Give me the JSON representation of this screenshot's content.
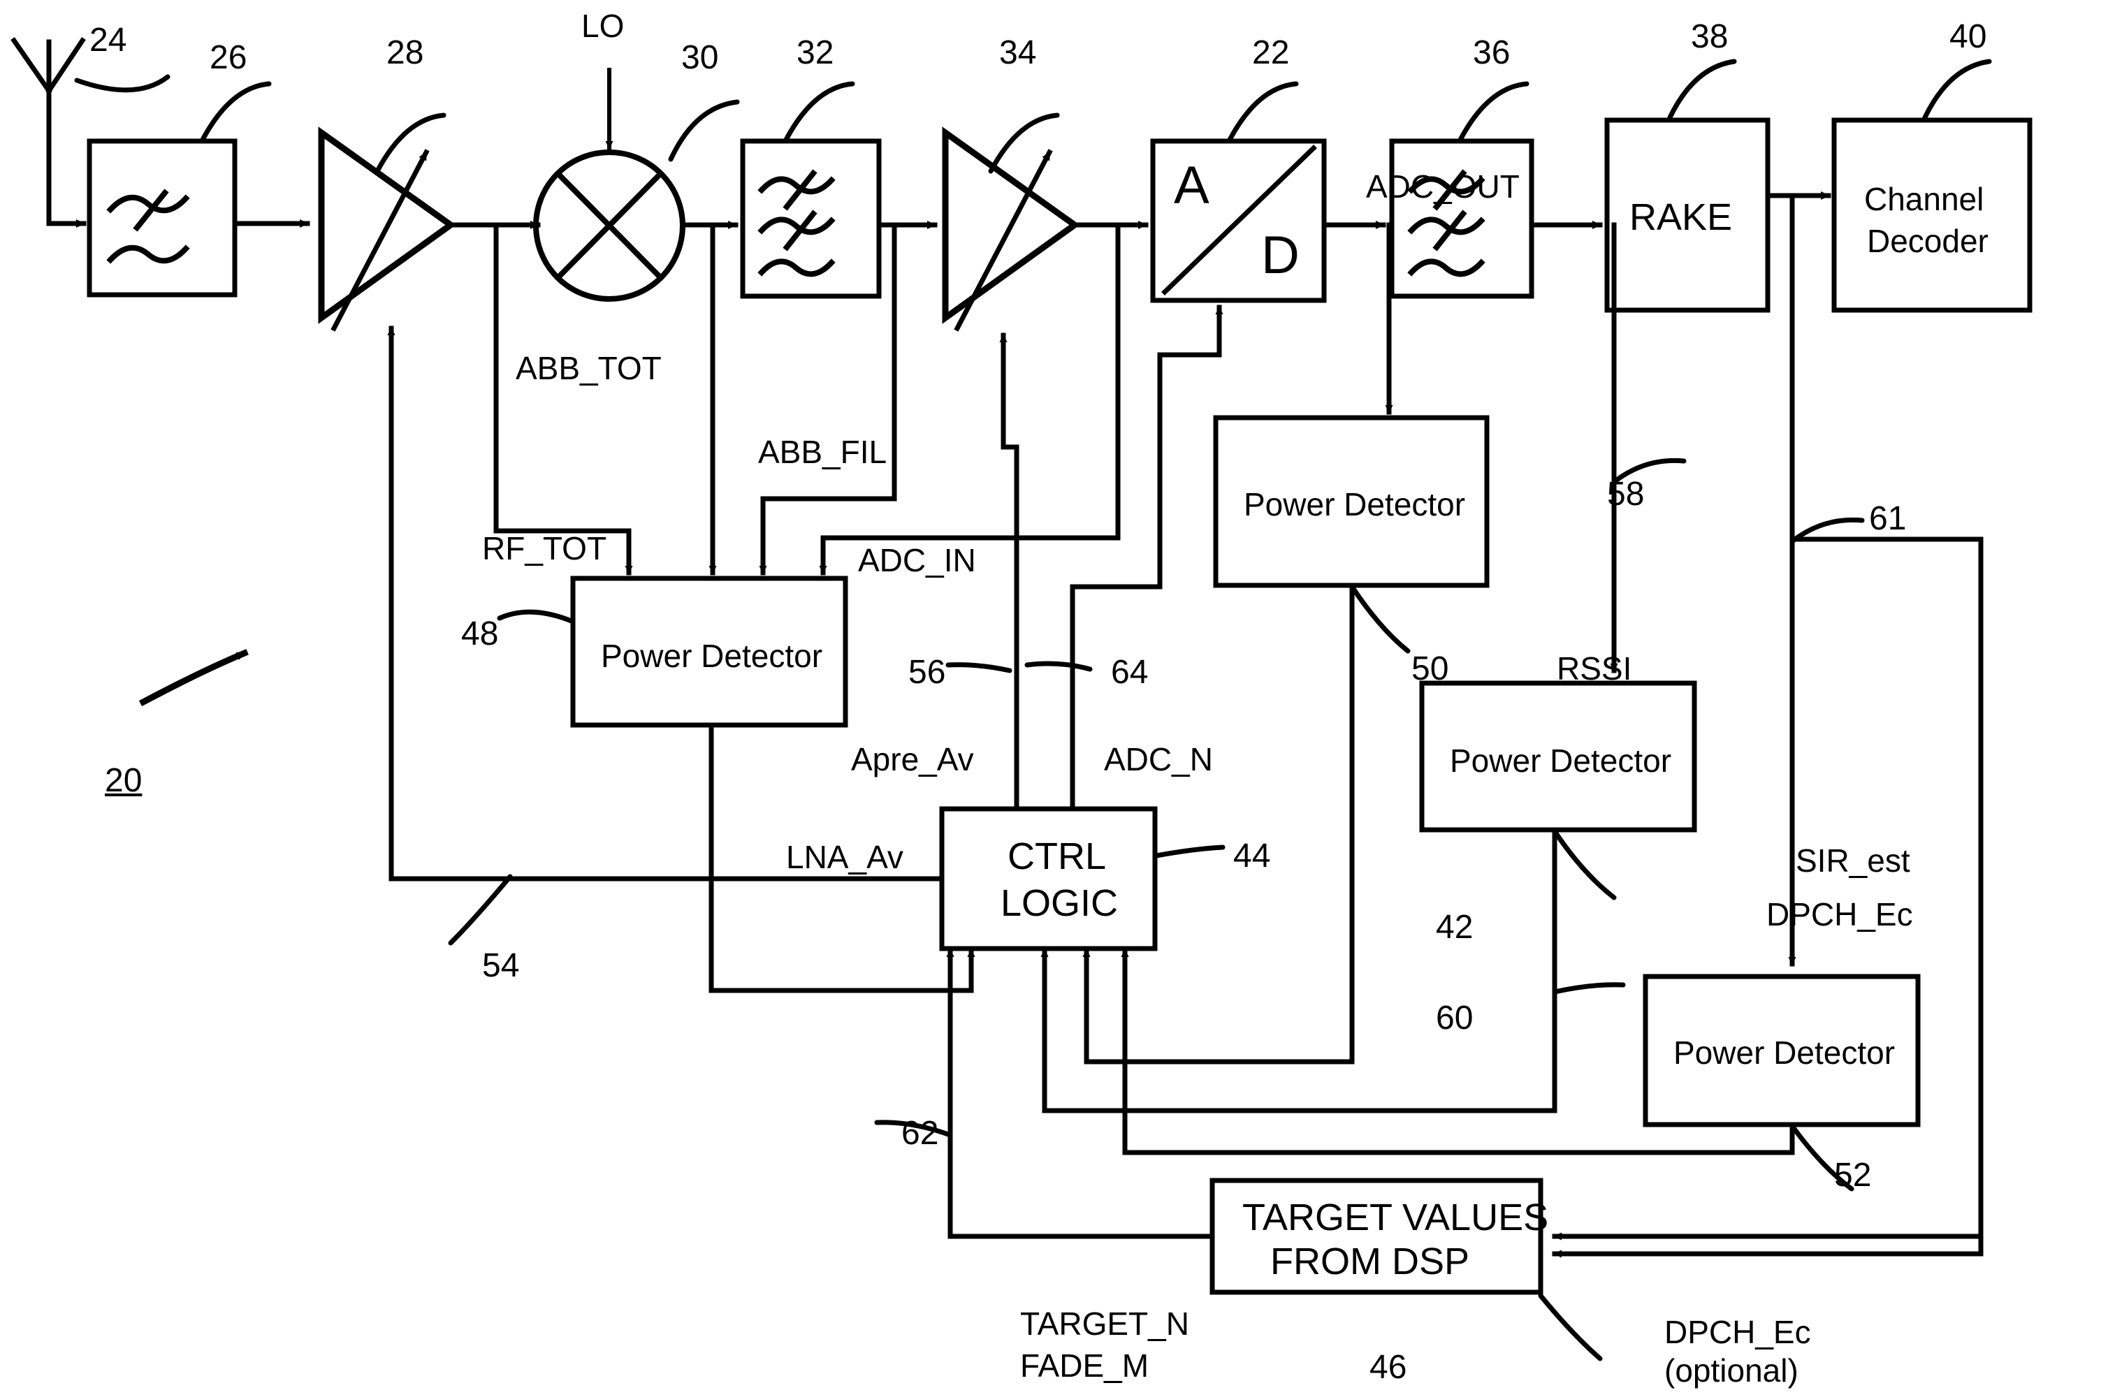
{
  "figure": {
    "id": "20",
    "type": "receiver-agc-block-diagram"
  },
  "blocks": [
    {
      "key": "rf_filter",
      "ref": "26",
      "label": "",
      "symbol": "bandpass-filter"
    },
    {
      "key": "lna",
      "ref": "28",
      "label": "",
      "symbol": "variable-gain-amplifier"
    },
    {
      "key": "mixer",
      "ref": "30",
      "label": "",
      "symbol": "mixer"
    },
    {
      "key": "bb_filter",
      "ref": "32",
      "label": "",
      "symbol": "bandpass-filter"
    },
    {
      "key": "vga",
      "ref": "34",
      "label": "",
      "symbol": "variable-gain-amplifier"
    },
    {
      "key": "adc",
      "ref": "22",
      "label_a": "A",
      "label_d": "D",
      "symbol": "analog-to-digital-converter"
    },
    {
      "key": "digital_filter",
      "ref": "36",
      "label": "",
      "symbol": "bandpass-filter"
    },
    {
      "key": "rake",
      "ref": "38",
      "label": "RAKE",
      "symbol": "rectangle"
    },
    {
      "key": "channel_decoder",
      "ref": "40",
      "label_line1": "Channel",
      "label_line2": "Decoder",
      "symbol": "rectangle"
    },
    {
      "key": "power_detector_48",
      "ref": "48",
      "label": "Power Detector",
      "symbol": "rectangle"
    },
    {
      "key": "power_detector_adc_out",
      "ref": "",
      "label": "Power Detector",
      "symbol": "rectangle"
    },
    {
      "key": "power_detector_42",
      "ref": "42",
      "label": "Power Detector",
      "symbol": "rectangle"
    },
    {
      "key": "power_detector_52",
      "ref": "52",
      "label": "Power Detector",
      "symbol": "rectangle"
    },
    {
      "key": "ctrl_logic",
      "ref": "44",
      "label_line1": "CTRL",
      "label_line2": "LOGIC",
      "symbol": "rectangle"
    },
    {
      "key": "target_values",
      "ref": "46",
      "label_line1": "TARGET VALUES",
      "label_line2": "FROM DSP",
      "symbol": "rectangle"
    }
  ],
  "reference_numerals": {
    "figure": "20",
    "adc": "22",
    "antenna": "24",
    "rf_filter": "26",
    "lna": "28",
    "mixer": "30",
    "bb_filter": "32",
    "vga": "34",
    "digital_filter": "36",
    "rake": "38",
    "channel_decoder": "40",
    "power_detector_42": "42",
    "ctrl_logic": "44",
    "target_values": "46",
    "power_detector_48": "48",
    "power_detector_50": "50",
    "power_detector_52": "52",
    "line_54": "54",
    "line_56": "56",
    "line_58": "58",
    "line_60": "60",
    "line_61": "61",
    "line_62": "62",
    "line_64": "64"
  },
  "signal_labels": {
    "lo": "LO",
    "abb_tot": "ABB_TOT",
    "abb_fil": "ABB_FIL",
    "rf_tot": "RF_TOT",
    "adc_in": "ADC_IN",
    "adc_out": "ADC_OUT",
    "rssi": "RSSI",
    "apre_av": "Apre_Av",
    "adc_n": "ADC_N",
    "lna_av": "LNA_Av",
    "sir_est": "SIR_est",
    "dpch_ec": "DPCH_Ec",
    "target_n": "TARGET_N",
    "fade_m": "FADE_M",
    "dpch_ec_optional_line1": "DPCH_Ec",
    "dpch_ec_optional_line2": "(optional)"
  },
  "block_labels": {
    "rake": "RAKE",
    "channel_decoder_line1": "Channel",
    "channel_decoder_line2": "Decoder",
    "power_detector": "Power Detector",
    "ctrl_logic_line1": "CTRL",
    "ctrl_logic_line2": "LOGIC",
    "target_values_line1": "TARGET VALUES",
    "target_values_line2": "FROM DSP",
    "adc_a": "A",
    "adc_d": "D"
  },
  "colors": {
    "ink": "#000000",
    "paper": "#ffffff"
  }
}
